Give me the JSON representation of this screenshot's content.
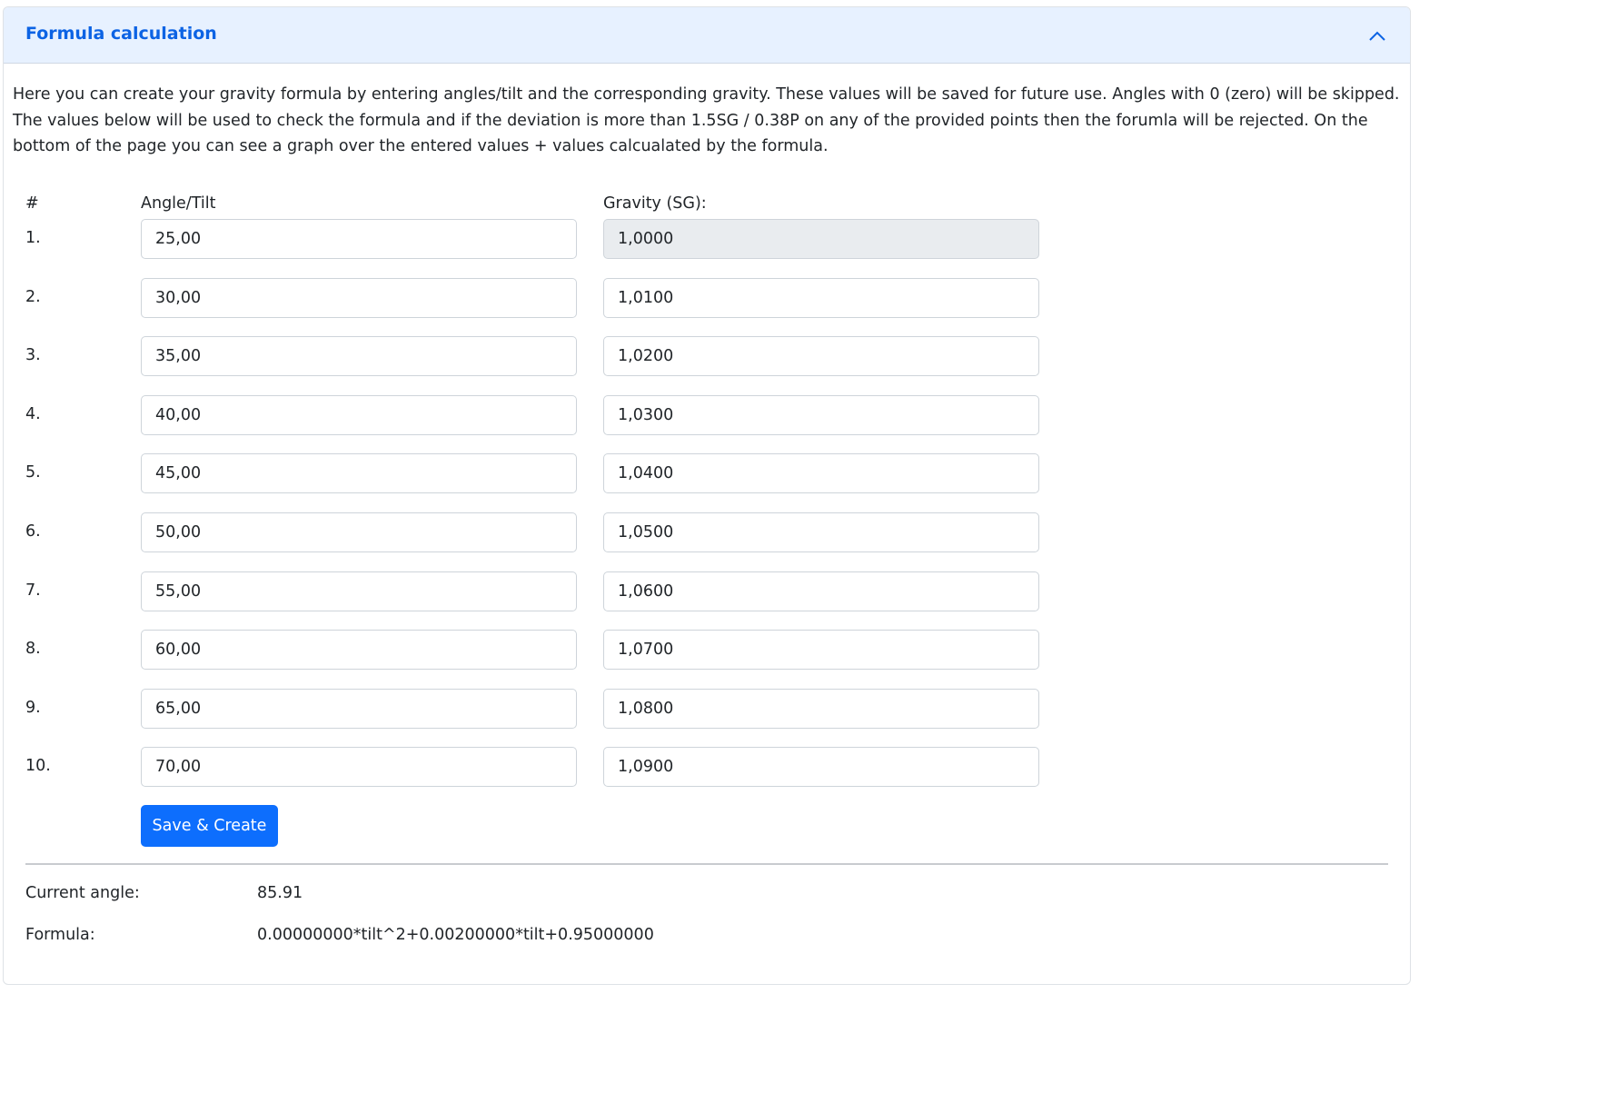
{
  "header": {
    "title": "Formula calculation",
    "toggle_icon": "chevron-up-icon"
  },
  "description": "Here you can create your gravity formula by entering angles/tilt and the corresponding gravity. These values will be saved for future use. Angles with 0 (zero) will be skipped. The values below will be used to check the formula and if the deviation is more than 1.5SG / 0.38P on any of the provided points then the forumla will be rejected. On the bottom of the page you can see a graph over the entered values + values calcualated by the formula.",
  "table": {
    "headers": {
      "number": "#",
      "angle": "Angle/Tilt",
      "gravity": "Gravity (SG):"
    },
    "rows": [
      {
        "num": "1.",
        "angle": "25,00",
        "gravity": "1,0000"
      },
      {
        "num": "2.",
        "angle": "30,00",
        "gravity": "1,0100"
      },
      {
        "num": "3.",
        "angle": "35,00",
        "gravity": "1,0200"
      },
      {
        "num": "4.",
        "angle": "40,00",
        "gravity": "1,0300"
      },
      {
        "num": "5.",
        "angle": "45,00",
        "gravity": "1,0400"
      },
      {
        "num": "6.",
        "angle": "50,00",
        "gravity": "1,0500"
      },
      {
        "num": "7.",
        "angle": "55,00",
        "gravity": "1,0600"
      },
      {
        "num": "8.",
        "angle": "60,00",
        "gravity": "1,0700"
      },
      {
        "num": "9.",
        "angle": "65,00",
        "gravity": "1,0800"
      },
      {
        "num": "10.",
        "angle": "70,00",
        "gravity": "1,0900"
      }
    ]
  },
  "actions": {
    "save_label": "Save & Create"
  },
  "info": {
    "current_angle_label": "Current angle:",
    "current_angle_value": "85.91",
    "formula_label": "Formula:",
    "formula_value": "0.00000000*tilt^2+0.00200000*tilt+0.95000000"
  },
  "colors": {
    "header_bg": "#e7f1ff",
    "header_title": "#0c63e4",
    "primary": "#0d6efd",
    "readonly_bg": "#e9ecef"
  }
}
